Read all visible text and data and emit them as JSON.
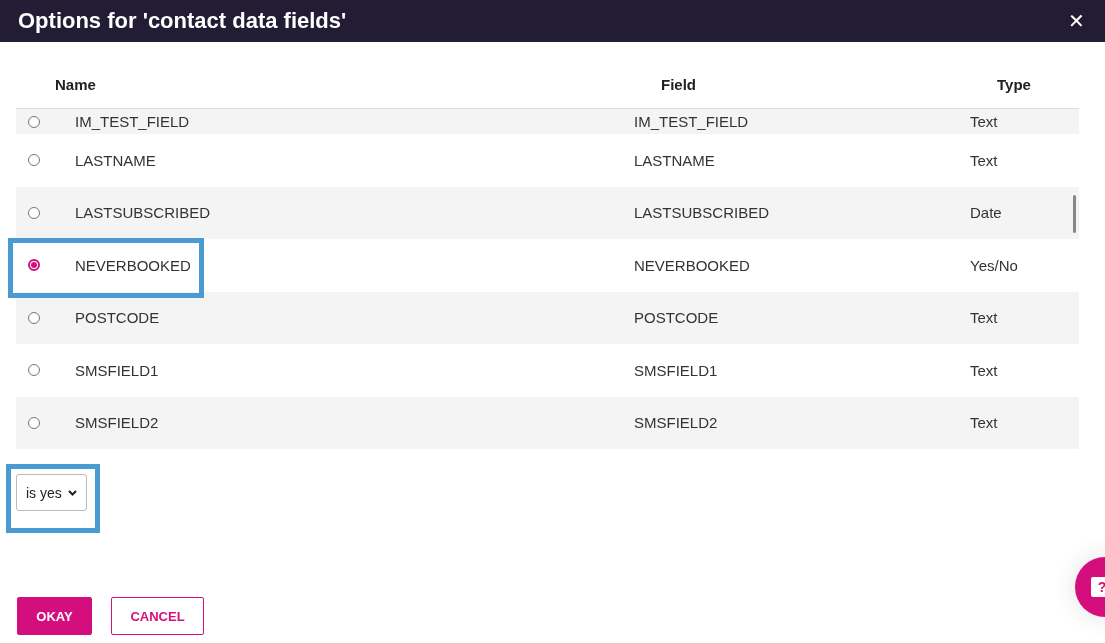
{
  "dialog": {
    "title": "Options for 'contact data fields'",
    "close_label": "✕"
  },
  "table": {
    "columns": [
      "Name",
      "Field",
      "Type"
    ],
    "rows": [
      {
        "name": "IM_TEST_FIELD",
        "field": "IM_TEST_FIELD",
        "type": "Text",
        "selected": false,
        "highlighted": false
      },
      {
        "name": "LASTNAME",
        "field": "LASTNAME",
        "type": "Text",
        "selected": false,
        "highlighted": false
      },
      {
        "name": "LASTSUBSCRIBED",
        "field": "LASTSUBSCRIBED",
        "type": "Date",
        "selected": false,
        "highlighted": false
      },
      {
        "name": "NEVERBOOKED",
        "field": "NEVERBOOKED",
        "type": "Yes/No",
        "selected": true,
        "highlighted": true
      },
      {
        "name": "POSTCODE",
        "field": "POSTCODE",
        "type": "Text",
        "selected": false,
        "highlighted": false
      },
      {
        "name": "SMSFIELD1",
        "field": "SMSFIELD1",
        "type": "Text",
        "selected": false,
        "highlighted": false
      },
      {
        "name": "SMSFIELD2",
        "field": "SMSFIELD2",
        "type": "Text",
        "selected": false,
        "highlighted": false
      }
    ]
  },
  "condition": {
    "value": "is yes",
    "highlighted": true
  },
  "buttons": [
    {
      "label": "OKAY",
      "kind": "primary"
    },
    {
      "label": "CANCEL",
      "kind": "secondary"
    }
  ],
  "help_button": {
    "label": "?"
  }
}
